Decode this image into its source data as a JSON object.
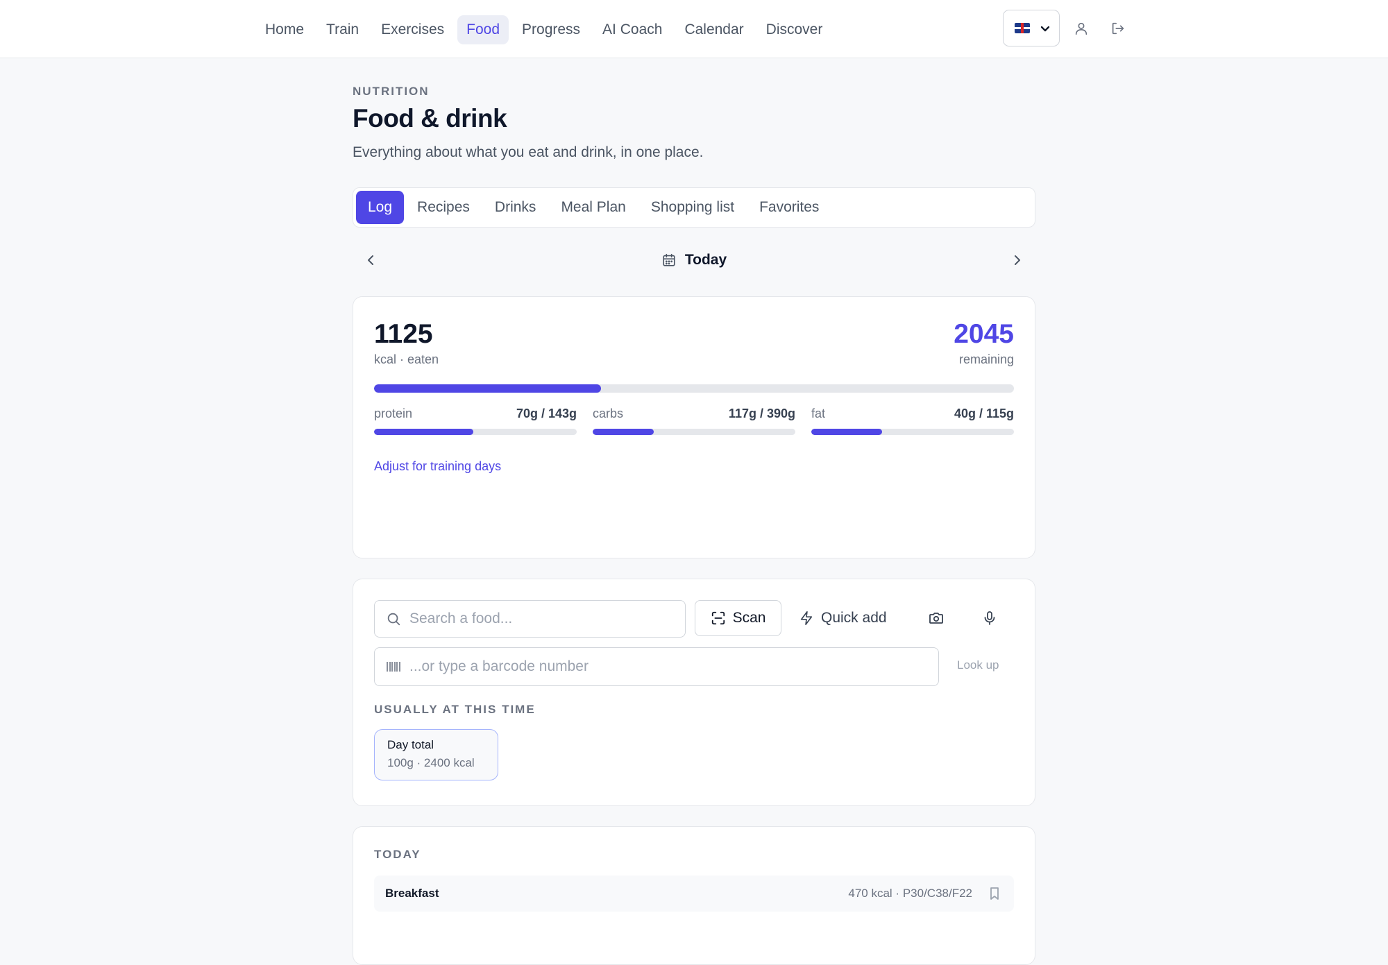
{
  "nav": {
    "items": [
      {
        "label": "Home"
      },
      {
        "label": "Train"
      },
      {
        "label": "Exercises"
      },
      {
        "label": "Food"
      },
      {
        "label": "Progress"
      },
      {
        "label": "AI Coach"
      },
      {
        "label": "Calendar"
      },
      {
        "label": "Discover"
      }
    ],
    "active": "Food",
    "language_flag": "uk-flag-icon"
  },
  "header": {
    "eyebrow": "NUTRITION",
    "title": "Food & drink",
    "subtitle": "Everything about what you eat and drink, in one place."
  },
  "tabs": [
    {
      "label": "Log"
    },
    {
      "label": "Recipes"
    },
    {
      "label": "Drinks"
    },
    {
      "label": "Meal Plan"
    },
    {
      "label": "Shopping list"
    },
    {
      "label": "Favorites"
    }
  ],
  "active_tab": "Log",
  "date": {
    "label": "Today"
  },
  "summary": {
    "eaten": "1125",
    "eaten_label": "kcal · eaten",
    "remaining": "2045",
    "remaining_label": "remaining",
    "progress_fraction": 0.355,
    "macros": [
      {
        "name": "protein",
        "value": "70g / 143g",
        "fraction": 0.49
      },
      {
        "name": "carbs",
        "value": "117g / 390g",
        "fraction": 0.3
      },
      {
        "name": "fat",
        "value": "40g / 115g",
        "fraction": 0.35
      }
    ],
    "adjust_link": "Adjust for training days"
  },
  "add_food": {
    "search_placeholder": "Search a food...",
    "scan_label": "Scan",
    "quick_add_label": "Quick add",
    "barcode_placeholder": "...or type a barcode number",
    "lookup_label": "Look up",
    "usual_label": "USUALLY AT THIS TIME",
    "chip": {
      "title": "Day total",
      "sub": "100g · 2400 kcal"
    }
  },
  "today": {
    "label": "TODAY",
    "meals": [
      {
        "name": "Breakfast",
        "stats": "470 kcal · P30/C38/F22"
      }
    ]
  },
  "colors": {
    "accent": "#4f46e5",
    "track": "#e5e7eb",
    "muted": "#6b7280"
  }
}
